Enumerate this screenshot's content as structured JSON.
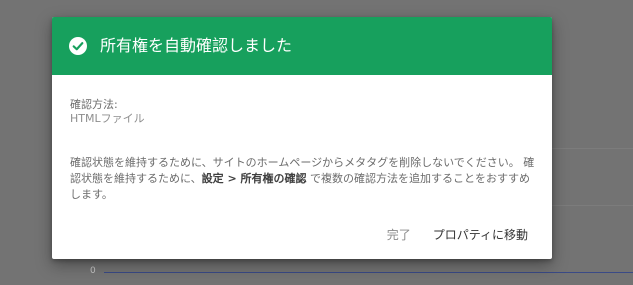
{
  "background": {
    "axis_label": "0"
  },
  "dialog": {
    "title": "所有権を自動確認しました",
    "header_color": "#17a05d",
    "icon": "check-circle-icon",
    "method_label": "確認方法:",
    "method_value": "HTMLファイル",
    "description": {
      "part1": "確認状態を維持するために、サイトのホームページからメタタグを削除しないでください。 確認状態を維持するために、",
      "bold": "設定 > 所有権の確認",
      "part2": " で複数の確認方法を追加することをおすすめします。"
    },
    "actions": {
      "done_label": "完了",
      "go_to_property_label": "プロパティに移動"
    }
  }
}
